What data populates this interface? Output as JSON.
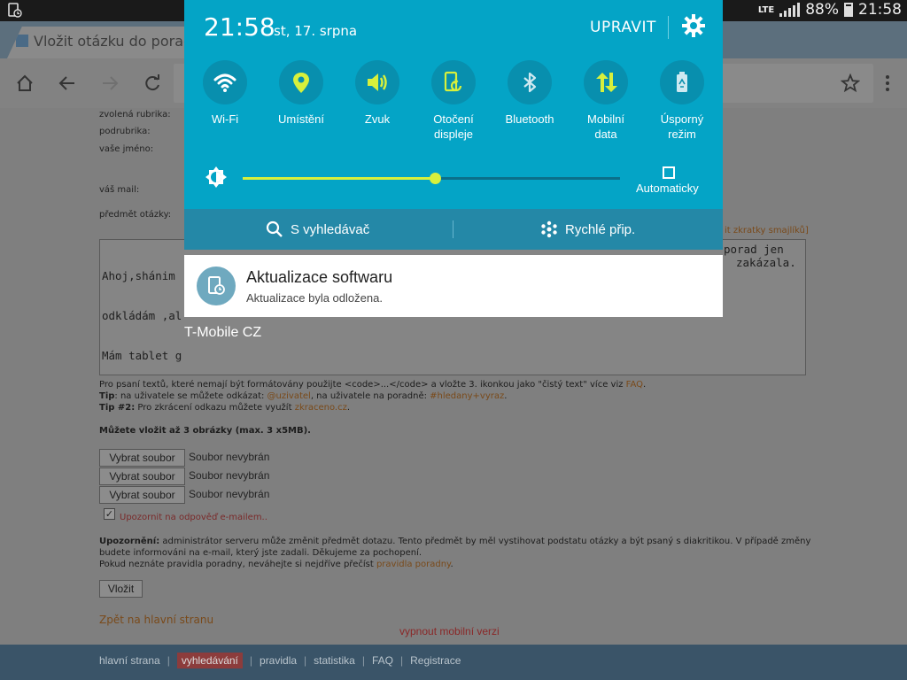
{
  "status_bar": {
    "network": "LTE",
    "battery": "88%",
    "time": "21:58",
    "battery_level": 0.88
  },
  "browser": {
    "tab_title": "Vložit otázku do poradny",
    "icons": [
      "home-icon",
      "back-icon",
      "forward-icon",
      "reload-icon",
      "star-icon",
      "menu-icon"
    ]
  },
  "form": {
    "labels": {
      "rubric": "zvolená rubrika:",
      "subrubric": "podrubrika:",
      "name": "vaše jméno:",
      "email": "váš mail:",
      "subject": "předmět otázky:"
    },
    "smileys_link": "it zkratky smajlíků]",
    "textarea_lines": [
      "Ahoj,shánim",
      "odkládám ,al",
      "Mám tablet g"
    ],
    "textarea_right_lines": [
      "porad jen",
      "zakázala."
    ],
    "hint1_a": "Pro psaní textů, které nemají být formátovány použijte <code>...</code> a vložte 3. ikonkou jako \"čistý text\" více viz ",
    "hint1_link": "FAQ",
    "hint1_end": ".",
    "tip_label": "Tip",
    "tip_text": ": na uživatele se můžete odkázat: ",
    "tip_link1": "@uzivatel",
    "tip_mid": ", na uživatele na poradně: ",
    "tip_link2": "#hledany+vyraz",
    "tip_end": ".",
    "tip2_label": "Tip #2:",
    "tip2_text": " Pro zkrácení odkazu můžete využít ",
    "tip2_link": "zkraceno.cz",
    "tip2_end": ".",
    "images_note": "Můžete vložit až 3 obrázky (max. 3 x5MB).",
    "file_button": "Vybrat soubor",
    "file_none": "Soubor nevybrán",
    "notify_label": "Upozornit na odpověď e-mailem..",
    "warning_label": "Upozornění:",
    "warning_text1": " administrátor serveru může změnit předmět dotazu. Tento předmět by měl vystihovat podstatu otázky a být psaný s diakritikou. V případě změny",
    "warning_text2": "budete informováni na e-mail, který jste zadali. Děkujeme za pochopení.",
    "rules_text": "Pokud neznáte pravidla poradny, neváhejte si nejdříve přečíst ",
    "rules_link": "pravidla poradny",
    "rules_end": ".",
    "submit": "Vložit",
    "back_link": "Zpět na hlavní stranu",
    "mobile_off": "vypnout mobilní verzi"
  },
  "footer_nav": [
    "hlavní strana",
    "vyhledávání",
    "pravidla",
    "statistika",
    "FAQ",
    "Registrace"
  ],
  "quick_panel": {
    "time": "21:58",
    "date": "st, 17. srpna",
    "edit": "UPRAVIT",
    "tiles": [
      {
        "label": "Wi-Fi",
        "icon": "wifi-icon",
        "color": "#ffffff"
      },
      {
        "label": "Umístění",
        "icon": "location-icon",
        "color": "#d7f03c"
      },
      {
        "label": "Zvuk",
        "icon": "sound-icon",
        "color": "#d7f03c"
      },
      {
        "label": "Otočení\ndispleje",
        "icon": "rotate-icon",
        "color": "#d7f03c"
      },
      {
        "label": "Bluetooth",
        "icon": "bluetooth-icon",
        "color": "#ffffff"
      },
      {
        "label": "Mobilní\ndata",
        "icon": "mobile-data-icon",
        "color": "#d7f03c"
      },
      {
        "label": "Úsporný\nrežim",
        "icon": "power-saving-icon",
        "color": "#ffffff"
      }
    ],
    "brightness": 0.51,
    "auto_brightness": "Automaticky",
    "s_finder": "S vyhledávač",
    "quick_connect": "Rychlé přip."
  },
  "notification": {
    "title": "Aktualizace softwaru",
    "subtitle": "Aktualizace byla odložena."
  },
  "carrier": "T-Mobile CZ",
  "colors": {
    "panel": "#04a4c6",
    "accent": "#d7f03c"
  }
}
